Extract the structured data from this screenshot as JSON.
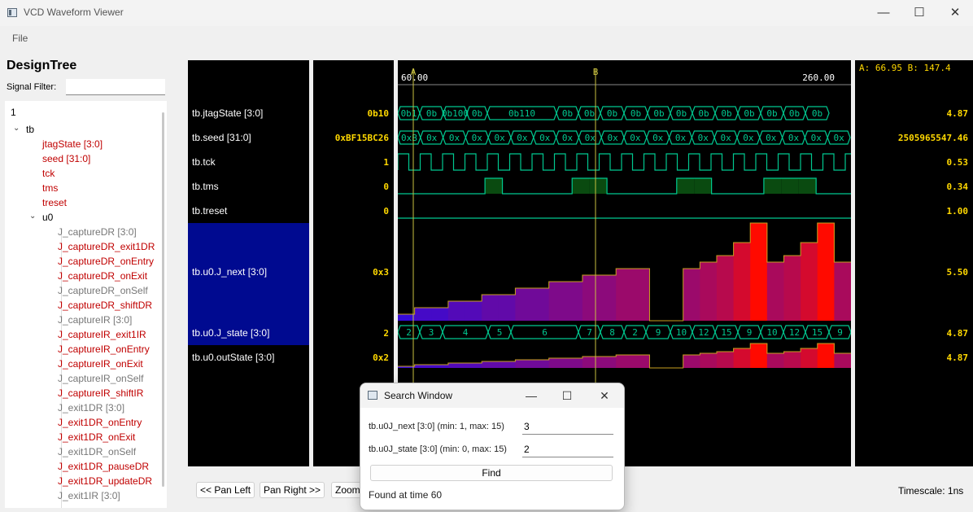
{
  "window": {
    "title": "VCD Waveform Viewer",
    "min": "—",
    "max": "☐",
    "close": "✕"
  },
  "menu": {
    "file": "File"
  },
  "sidebar": {
    "title": "DesignTree",
    "filter_label": "Signal Filter:",
    "filter_value": "",
    "root": "1",
    "tb": "tb",
    "tb_children": [
      {
        "label": "jtagState [3:0]",
        "state": "red"
      },
      {
        "label": "seed [31:0]",
        "state": "red"
      },
      {
        "label": "tck",
        "state": "red"
      },
      {
        "label": "tms",
        "state": "red"
      },
      {
        "label": "treset",
        "state": "red"
      }
    ],
    "u0": "u0",
    "u0_children": [
      {
        "label": "J_captureDR [3:0]",
        "state": "gray"
      },
      {
        "label": "J_captureDR_exit1DR",
        "state": "red"
      },
      {
        "label": "J_captureDR_onEntry",
        "state": "red"
      },
      {
        "label": "J_captureDR_onExit",
        "state": "red"
      },
      {
        "label": "J_captureDR_onSelf",
        "state": "gray"
      },
      {
        "label": "J_captureDR_shiftDR",
        "state": "red"
      },
      {
        "label": "J_captureIR [3:0]",
        "state": "gray"
      },
      {
        "label": "J_captureIR_exit1IR",
        "state": "red"
      },
      {
        "label": "J_captureIR_onEntry",
        "state": "red"
      },
      {
        "label": "J_captureIR_onExit",
        "state": "red"
      },
      {
        "label": "J_captureIR_onSelf",
        "state": "gray"
      },
      {
        "label": "J_captureIR_shiftIR",
        "state": "red"
      },
      {
        "label": "J_exit1DR [3:0]",
        "state": "gray"
      },
      {
        "label": "J_exit1DR_onEntry",
        "state": "red"
      },
      {
        "label": "J_exit1DR_onExit",
        "state": "red"
      },
      {
        "label": "J_exit1DR_onSelf",
        "state": "gray"
      },
      {
        "label": "J_exit1DR_pauseDR",
        "state": "red"
      },
      {
        "label": "J_exit1DR_updateDR",
        "state": "red"
      },
      {
        "label": "J_exit1IR [3:0]",
        "state": "gray"
      }
    ]
  },
  "time_axis": {
    "start": "60.00",
    "end": "260.00",
    "marker_a": "A",
    "marker_b": "B"
  },
  "cursor_readout": "A: 66.95 B: 147.4",
  "signals": [
    {
      "name": "tb.jtagState [3:0]",
      "value": "0b10",
      "right": "4.87"
    },
    {
      "name": "tb.seed [31:0]",
      "value": "0xBF15BC26",
      "right": "2505965547.46"
    },
    {
      "name": "tb.tck",
      "value": "1",
      "right": "0.53"
    },
    {
      "name": "tb.tms",
      "value": "0",
      "right": "0.34"
    },
    {
      "name": "tb.treset",
      "value": "0",
      "right": "1.00"
    },
    {
      "name": "tb.u0.J_next [3:0]",
      "value": "0x3",
      "right": "5.50"
    },
    {
      "name": "tb.u0.J_state [3:0]",
      "value": "2",
      "right": "4.87"
    },
    {
      "name": "tb.u0.outState [3:0]",
      "value": "0x2",
      "right": "4.87"
    }
  ],
  "waves": {
    "jtagState": [
      "0b1",
      "0b",
      "0b100",
      "0b",
      "0b110",
      "0b",
      "0b",
      "0b",
      "0b",
      "0b",
      "0b",
      "0b",
      "0b",
      "0b",
      "0b",
      "0b",
      "0b"
    ],
    "seed": [
      "0xB",
      "0x",
      "0x",
      "0x",
      "0x",
      "0x",
      "0x",
      "0x",
      "0x",
      "0x",
      "0x",
      "0x",
      "0x",
      "0x",
      "0x",
      "0x",
      "0x",
      "0x",
      "0x",
      "0x"
    ],
    "j_state": [
      "2",
      "3",
      "4",
      "5",
      "6",
      "7",
      "8",
      "2",
      "9",
      "10",
      "12",
      "15",
      "9",
      "10",
      "12",
      "15",
      "9"
    ],
    "j_next_levels": [
      1,
      2,
      2,
      3,
      3,
      4,
      4,
      5,
      5,
      6,
      6,
      7,
      7,
      8,
      8,
      0,
      0,
      8,
      9,
      10,
      12,
      15,
      9,
      10,
      12,
      15,
      9
    ],
    "tms_levels": [
      0,
      0,
      0,
      0,
      0,
      1,
      0,
      0,
      0,
      0,
      1,
      1,
      0,
      0,
      0,
      0,
      1,
      1,
      0,
      0,
      0,
      1,
      1,
      1,
      0,
      0
    ]
  },
  "bottom": {
    "pan_left": "<< Pan Left",
    "pan_right": "Pan Right >>",
    "zoom": "Zoom In",
    "timescale": "Timescale: 1ns"
  },
  "search": {
    "title": "Search Window",
    "field1_label": "tb.u0J_next [3:0] (min: 1, max: 15)",
    "field1_value": "3",
    "field2_label": "tb.u0J_state [3:0] (min: 0, max: 15)",
    "field2_value": "2",
    "find": "Find",
    "status": "Found at time 60"
  },
  "colors": {
    "wave_green": "#00c890",
    "cursor": "#c8c040",
    "value_yellow": "#ffd800",
    "selection": "#000a90"
  }
}
